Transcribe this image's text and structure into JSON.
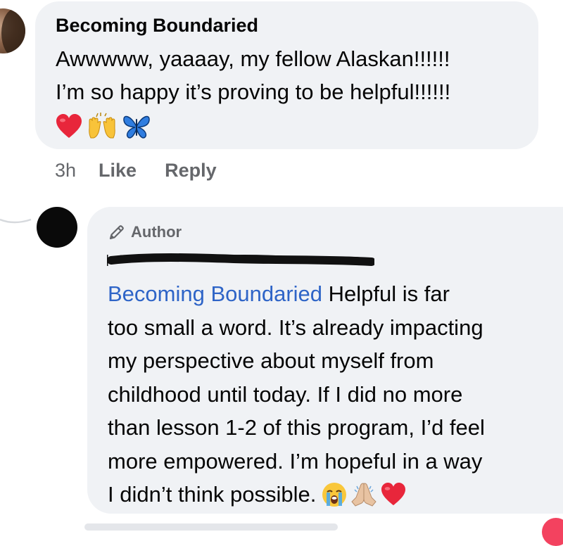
{
  "comment1": {
    "author": "Becoming Boundaried",
    "lines": [
      "Awwwww, yaaaay, my fellow Alaskan!!!!!!",
      "I’m so happy it’s proving to be helpful!!!!!!"
    ],
    "emojis": [
      "heart-emoji",
      "raising-hands-emoji",
      "butterfly-emoji"
    ],
    "timestamp": "3h",
    "like_label": "Like",
    "reply_label": "Reply"
  },
  "comment2": {
    "badge_label": "Author",
    "mention": "Becoming Boundaried",
    "lines": [
      " Helpful is far",
      "too small a word. It’s already impacting",
      "my perspective about myself from",
      "childhood until today. If I did no more",
      "than lesson 1-2 of this program, I’d feel",
      "more empowered. I’m hopeful in a way",
      "I didn’t think possible."
    ],
    "emojis": [
      "crying-face-emoji",
      "folded-hands-emoji",
      "heart-emoji"
    ]
  },
  "colors": {
    "bubble": "#f0f2f5",
    "mention_blue": "#2e64c7",
    "secondary_text": "#65676b",
    "heart_red": "#e8263b"
  }
}
